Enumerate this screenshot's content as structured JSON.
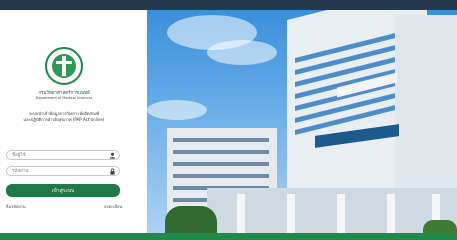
{
  "org": {
    "name_th": "กรมวิทยาศาสตร์การแพทย์",
    "name_en": "Department of Medical Sciences"
  },
  "system": {
    "line1": "ระบบนำเข้าข้อมูลการวิเคราะห์ผลิตภัณฑ์",
    "line2": "และปฏิบัติการอ้างอิงสุขภาพ (PAP Act online)"
  },
  "form": {
    "username_placeholder": "ชื่อผู้ใช้",
    "password_placeholder": "รหัสผ่าน",
    "login_label": "เข้าสู่ระบบ",
    "link_left": "ลืมรหัสผ่าน",
    "link_right": "ลงทะเบียน"
  },
  "icons": {
    "user_icon": "user-icon",
    "lock_icon": "lock-icon"
  },
  "colors": {
    "brand_green": "#1f7a47",
    "footer_green": "#1f8a4a",
    "topbar": "#263a4f"
  }
}
